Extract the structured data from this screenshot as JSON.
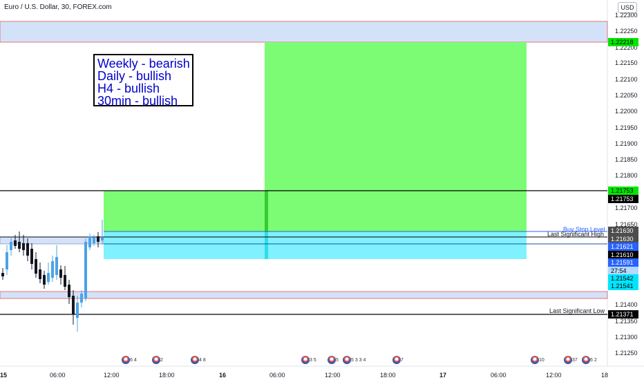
{
  "chart": {
    "title": "Euro / U.S. Dollar, 30, FOREX.com",
    "currency": "USD",
    "annotation_lines": [
      "Weekly - bearish",
      "Daily - bullish",
      "H4 - bullish",
      "30min - bullish"
    ],
    "price_ticks": [
      "1.22300",
      "1.22250",
      "1.22200",
      "1.22150",
      "1.22100",
      "1.22050",
      "1.22000",
      "1.21950",
      "1.21900",
      "1.21850",
      "1.21800",
      "1.21700",
      "1.21650",
      "1.21400",
      "1.21350",
      "1.21300",
      "1.21250"
    ],
    "price_tags": [
      {
        "label": "1.22218",
        "bg": "#00e600",
        "fg": "#000000"
      },
      {
        "label": "1.21753",
        "bg": "#00e600",
        "fg": "#000000"
      },
      {
        "label": "1.21753",
        "bg": "#000000",
        "fg": "#ffffff"
      },
      {
        "label": "1.21630",
        "bg": "#4d4d4d",
        "fg": "#ffffff"
      },
      {
        "label": "1.21630",
        "bg": "#4d4d4d",
        "fg": "#ffffff"
      },
      {
        "label": "1.21621",
        "bg": "#2962ff",
        "fg": "#ffffff"
      },
      {
        "label": "1.21610",
        "bg": "#000000",
        "fg": "#ffffff"
      },
      {
        "label": "1.21591",
        "bg": "#2962ff",
        "fg": "#ffffff"
      },
      {
        "label": "27:54",
        "bg": "#b3d9ff",
        "fg": "#000000"
      },
      {
        "label": "1.21542",
        "bg": "#00e5ff",
        "fg": "#000000"
      },
      {
        "label": "1.21541",
        "bg": "#00e5ff",
        "fg": "#000000"
      },
      {
        "label": "1.21371",
        "bg": "#000000",
        "fg": "#ffffff"
      }
    ],
    "time_ticks": [
      "15",
      "06:00",
      "12:00",
      "18:00",
      "16",
      "06:00",
      "12:00",
      "18:00",
      "17",
      "06:00",
      "12:00",
      "18"
    ],
    "line_labels": {
      "buy_stop": "Buy Stop Level",
      "last_high": "Last Significant High",
      "last_low": "Last Significant Low"
    },
    "events": [
      "6 4",
      "2",
      "4 8",
      "3 5",
      "5",
      "5 3 3 4",
      "7",
      "10",
      "37",
      "6 2"
    ],
    "colors": {
      "target_zone": "#7cfc74",
      "stop_zone": "#7ff1ff",
      "supply_zone": "#d4e2f9",
      "bull_candle": "#4aa3e8",
      "bear_candle": "#131722",
      "zone_border": "#e57373"
    }
  }
}
